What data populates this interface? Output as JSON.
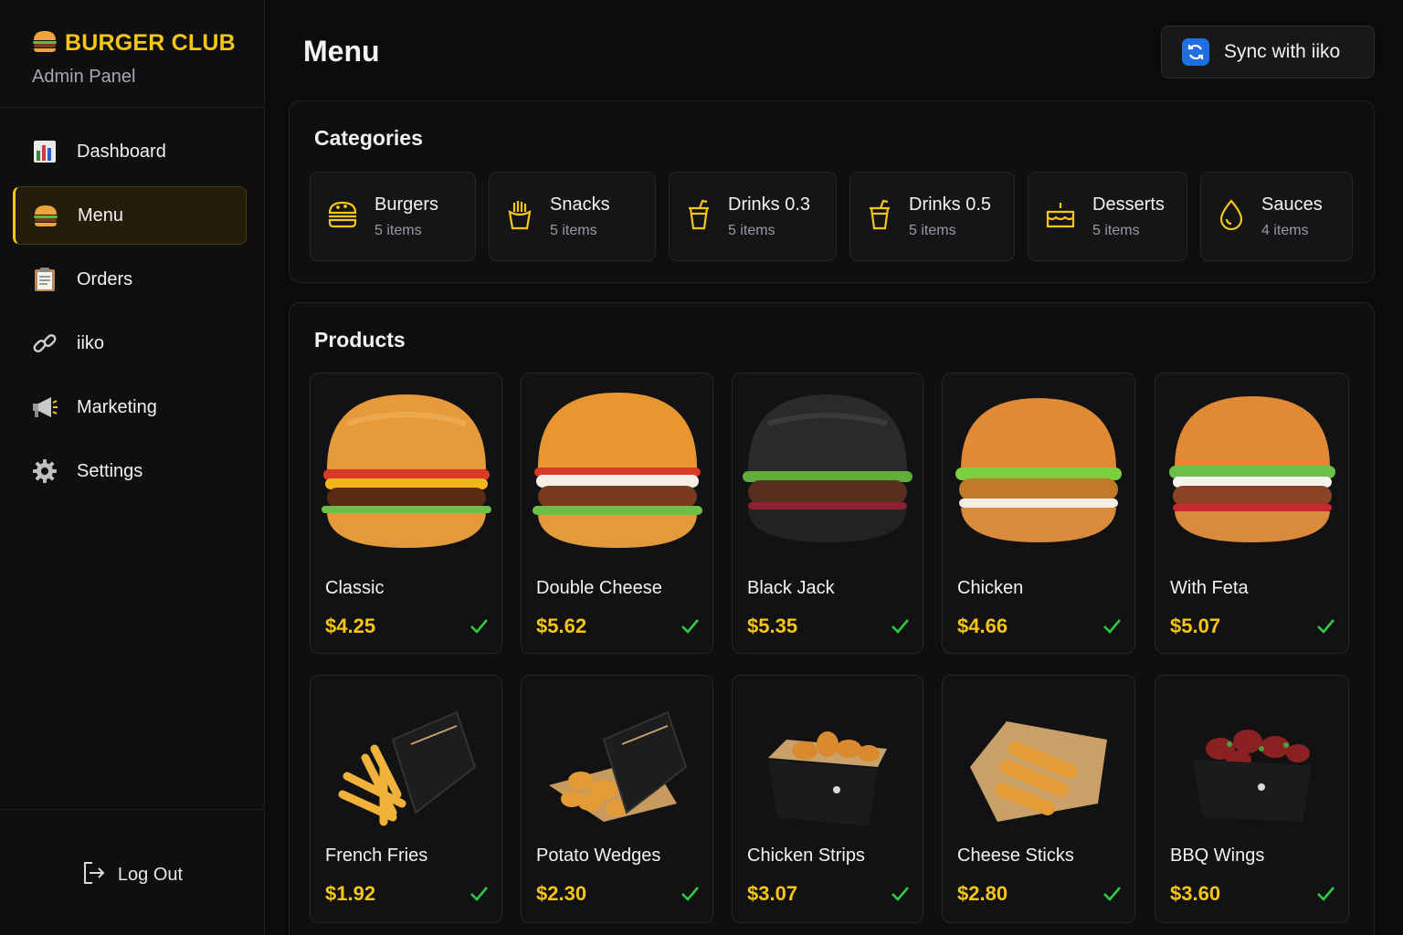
{
  "sidebar": {
    "brand": "BURGER CLUB",
    "subtitle": "Admin Panel",
    "nav": [
      {
        "label": "Dashboard",
        "icon": "chart-icon"
      },
      {
        "label": "Menu",
        "icon": "burger-icon",
        "active": true
      },
      {
        "label": "Orders",
        "icon": "clipboard-icon"
      },
      {
        "label": "iiko",
        "icon": "link-icon"
      },
      {
        "label": "Marketing",
        "icon": "megaphone-icon"
      },
      {
        "label": "Settings",
        "icon": "gear-icon"
      }
    ],
    "logout": "Log Out"
  },
  "header": {
    "title": "Menu",
    "sync_label": "Sync with iiko"
  },
  "categories": {
    "title": "Categories",
    "items": [
      {
        "name": "Burgers",
        "count": "5 items",
        "icon": "burger-outline-icon"
      },
      {
        "name": "Snacks",
        "count": "5 items",
        "icon": "fries-icon"
      },
      {
        "name": "Drinks 0.3",
        "count": "5 items",
        "icon": "cup-icon"
      },
      {
        "name": "Drinks 0.5",
        "count": "5 items",
        "icon": "cup-icon"
      },
      {
        "name": "Desserts",
        "count": "5 items",
        "icon": "cake-icon"
      },
      {
        "name": "Sauces",
        "count": "4 items",
        "icon": "drop-icon"
      }
    ]
  },
  "products": {
    "title": "Products",
    "items": [
      {
        "name": "Classic",
        "price": "$4.25",
        "image": "burger-photo",
        "available": true
      },
      {
        "name": "Double Cheese",
        "price": "$5.62",
        "image": "burger-photo",
        "available": true
      },
      {
        "name": "Black Jack",
        "price": "$5.35",
        "image": "black-burger-photo",
        "available": true
      },
      {
        "name": "Chicken",
        "price": "$4.66",
        "image": "burger-photo",
        "available": true
      },
      {
        "name": "With Feta",
        "price": "$5.07",
        "image": "burger-photo",
        "available": true
      },
      {
        "name": "French Fries",
        "price": "$1.92",
        "image": "fries-photo",
        "available": true
      },
      {
        "name": "Potato Wedges",
        "price": "$2.30",
        "image": "wedges-photo",
        "available": true
      },
      {
        "name": "Chicken Strips",
        "price": "$3.07",
        "image": "strips-photo",
        "available": true
      },
      {
        "name": "Cheese Sticks",
        "price": "$2.80",
        "image": "cheese-sticks-photo",
        "available": true
      },
      {
        "name": "BBQ Wings",
        "price": "$3.60",
        "image": "wings-photo",
        "available": true
      }
    ]
  },
  "colors": {
    "accent": "#f5c518",
    "check": "#2ecc40",
    "sync_icon_bg": "#1f6fe0"
  }
}
